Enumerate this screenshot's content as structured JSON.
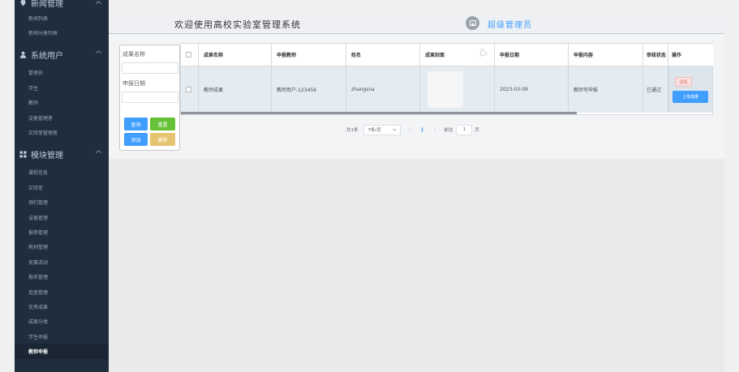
{
  "header": {
    "title": "欢迎使用高校实验室管理系统",
    "user": "超级管理员"
  },
  "sidebar": {
    "groups": [
      {
        "label": "新闻管理",
        "icon": "pin-icon",
        "items": [
          "新闻列表",
          "新闻分类列表"
        ]
      },
      {
        "label": "系统用户",
        "icon": "user-icon",
        "items": [
          "管理员",
          "学生",
          "教师",
          "设备管理者",
          "实验室管理者"
        ]
      },
      {
        "label": "模块管理",
        "icon": "grid-icon",
        "items": [
          "课程信息",
          "实验室",
          "预约管理",
          "设备管理",
          "报修管理",
          "耗材管理",
          "竞赛活动",
          "报名管理",
          "追查管理",
          "优秀成果",
          "成果分类",
          "学生申报",
          "教师申报"
        ]
      }
    ],
    "active_item": "教师申报"
  },
  "search": {
    "field1_label": "成果名称",
    "field1_value": "",
    "field2_label": "申报日期",
    "field2_value": "",
    "query_button": "查询",
    "reset_button": "重置",
    "add_button": "添加",
    "delete_button": "删除"
  },
  "table": {
    "columns": [
      "成果名称",
      "申报教师",
      "姓名",
      "成果封面",
      "申报日期",
      "申报内容",
      "审核状态",
      "操作"
    ],
    "rows": [
      {
        "name": "教师成果",
        "teacher": "教师用户-123456",
        "full_name": "zhangsna",
        "cover": "",
        "date": "2023-03-09",
        "content": "教师可申报",
        "status": "已通过",
        "detail_button": "详情",
        "upload_button": "上传成果"
      }
    ]
  },
  "pagination": {
    "total": "共1条",
    "page_size": "7条/页",
    "current": "1",
    "goto_label": "前往",
    "goto_value": "1",
    "page_suffix": "页"
  },
  "colors": {
    "sidebar_bg": "#1f2d3d",
    "primary": "#409eff",
    "success": "#67c23a",
    "warning": "#e6c46f",
    "danger_light": "#f9e0e0"
  }
}
